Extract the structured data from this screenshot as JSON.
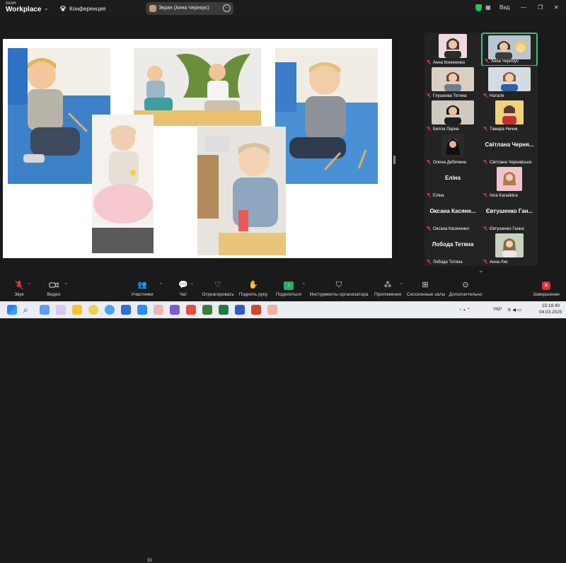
{
  "titlebar": {
    "logo_line1": "zoom",
    "logo_line2": "Workplace",
    "conference_label": "Конференция",
    "share_title": "Экран (Анна Черноус)",
    "view_label": "Вид"
  },
  "gallery": {
    "tiles": [
      {
        "name": "Анна Кононенко",
        "type": "video"
      },
      {
        "name": "Анна Черноус",
        "type": "video",
        "active": true
      },
      {
        "name": "Глушкова Тетяна",
        "type": "video"
      },
      {
        "name": "Наталя",
        "type": "video"
      },
      {
        "name": "Белла Ларна",
        "type": "video"
      },
      {
        "name": "Тамара Ничик",
        "type": "video"
      },
      {
        "name": "Олена Дебичина",
        "type": "video"
      },
      {
        "name": "Світлана Чернявська",
        "type": "text",
        "big": "Світлана Черня..."
      },
      {
        "name": "Еліна",
        "type": "text",
        "big": "Еліна"
      },
      {
        "name": "Inna Kanaikina",
        "type": "video"
      },
      {
        "name": "Оксана Касяненко",
        "type": "text",
        "big": "Оксана Касяне..."
      },
      {
        "name": "Євтушенко Ганна",
        "type": "text",
        "big": "Євтушенко Ган..."
      },
      {
        "name": "Лобода Тетяна",
        "type": "text",
        "big": "Лобода Тетяна"
      },
      {
        "name": "Анна Лис",
        "type": "video"
      }
    ]
  },
  "toolbar": {
    "audio": "Звук",
    "video": "Видео",
    "participants": "Участники",
    "participants_count": "33",
    "chat": "Чат",
    "react": "Отреагировать",
    "raise_hand": "Поднять руку",
    "share": "Поделиться",
    "host_tools": "Инструменты организатора",
    "apps": "Приложения",
    "breakout": "Сессионные залы",
    "more": "Дополнительно",
    "end": "Завершение"
  },
  "taskbar": {
    "language": "УКР",
    "time": "15:18:40",
    "date": "04.03.2025"
  },
  "colors": {
    "active_border": "#3cc07a",
    "share_green": "#23b061",
    "end_red": "#e02f3a"
  }
}
